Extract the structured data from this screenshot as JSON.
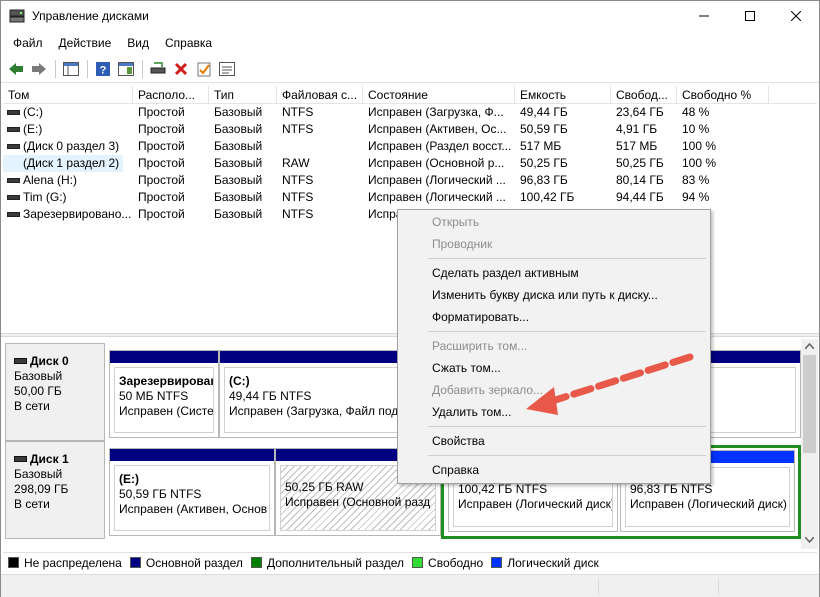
{
  "window": {
    "title": "Управление дисками"
  },
  "menu": [
    "Файл",
    "Действие",
    "Вид",
    "Справка"
  ],
  "columns": [
    "Том",
    "Располо...",
    "Тип",
    "Файловая с...",
    "Состояние",
    "Емкость",
    "Свобод...",
    "Свободно %"
  ],
  "volumes": [
    [
      "(C:)",
      "Простой",
      "Базовый",
      "NTFS",
      "Исправен (Загрузка, Ф...",
      "49,44 ГБ",
      "23,64 ГБ",
      "48 %"
    ],
    [
      "(E:)",
      "Простой",
      "Базовый",
      "NTFS",
      "Исправен (Активен, Ос...",
      "50,59 ГБ",
      "4,91 ГБ",
      "10 %"
    ],
    [
      "(Диск 0 раздел 3)",
      "Простой",
      "Базовый",
      "",
      "Исправен (Раздел восст...",
      "517 МБ",
      "517 МБ",
      "100 %"
    ],
    [
      "(Диск 1 раздел 2)",
      "Простой",
      "Базовый",
      "RAW",
      "Исправен (Основной р...",
      "50,25 ГБ",
      "50,25 ГБ",
      "100 %"
    ],
    [
      "Alena (H:)",
      "Простой",
      "Базовый",
      "NTFS",
      "Исправен (Логический ...",
      "96,83 ГБ",
      "80,14 ГБ",
      "83 %"
    ],
    [
      "Tim (G:)",
      "Простой",
      "Базовый",
      "NTFS",
      "Исправен (Логический ...",
      "100,42 ГБ",
      "94,44 ГБ",
      "94 %"
    ],
    [
      "Зарезервировано...",
      "Простой",
      "Базовый",
      "NTFS",
      "Испра",
      "",
      "",
      ""
    ]
  ],
  "disks": [
    {
      "name": "Диск 0",
      "type": "Базовый",
      "size": "50,00 ГБ",
      "status": "В сети",
      "partitions": [
        {
          "title": "Зарезервирован",
          "line1": "50 МБ NTFS",
          "line2": "Исправен (Систе"
        },
        {
          "title": "(C:)",
          "line1": "49,44 ГБ NTFS",
          "line2": "Исправен (Загрузка, Файл подк"
        }
      ]
    },
    {
      "name": "Диск 1",
      "type": "Базовый",
      "size": "298,09 ГБ",
      "status": "В сети",
      "partitions": [
        {
          "title": "(E:)",
          "line1": "50,59 ГБ NTFS",
          "line2": "Исправен (Активен, Основ"
        },
        {
          "title": "",
          "line1": "50,25 ГБ RAW",
          "line2": "Исправен (Основной разд"
        },
        {
          "title": "",
          "line1": "100,42 ГБ NTFS",
          "line2": "Исправен (Логический диск)"
        },
        {
          "title": "",
          "line1": "96,83 ГБ NTFS",
          "line2": "Исправен (Логический диск)"
        }
      ]
    }
  ],
  "legend": [
    {
      "label": "Не распределена",
      "color": "#000000"
    },
    {
      "label": "Основной раздел",
      "color": "#000080"
    },
    {
      "label": "Дополнительный раздел",
      "color": "#008000"
    },
    {
      "label": "Свободно",
      "color": "#33dd33"
    },
    {
      "label": "Логический диск",
      "color": "#0033ff"
    }
  ],
  "context_menu": {
    "open": "Открыть",
    "explorer": "Проводник",
    "make_active": "Сделать раздел активным",
    "change_letter": "Изменить букву диска или путь к диску...",
    "format": "Форматировать...",
    "extend": "Расширить том...",
    "shrink": "Сжать том...",
    "add_mirror": "Добавить зеркало...",
    "delete": "Удалить том...",
    "properties": "Свойства",
    "help": "Справка"
  },
  "colors": {
    "primary_bar": "#000080",
    "logical_bar": "#0033ff",
    "extended_border": "#1e8f1e",
    "arrow": "#e8594a"
  }
}
